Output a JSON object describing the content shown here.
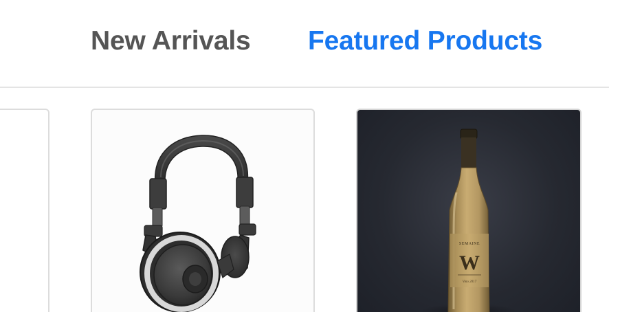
{
  "tabs": {
    "new_arrivals": "New Arrivals",
    "featured_products": "Featured Products",
    "active": "featured_products"
  },
  "colors": {
    "active_tab": "#1777f0",
    "inactive_tab": "#555555",
    "divider": "#e4e4e4",
    "card_border": "#dcdcdc"
  },
  "products": [
    {
      "name": "product-card-partial",
      "image": "blank-image"
    },
    {
      "name": "product-card-headphones",
      "image": "headphones-image"
    },
    {
      "name": "product-card-wine",
      "image": "wine-bottle-image",
      "label_text": [
        "W",
        "SEMAINE"
      ]
    }
  ]
}
